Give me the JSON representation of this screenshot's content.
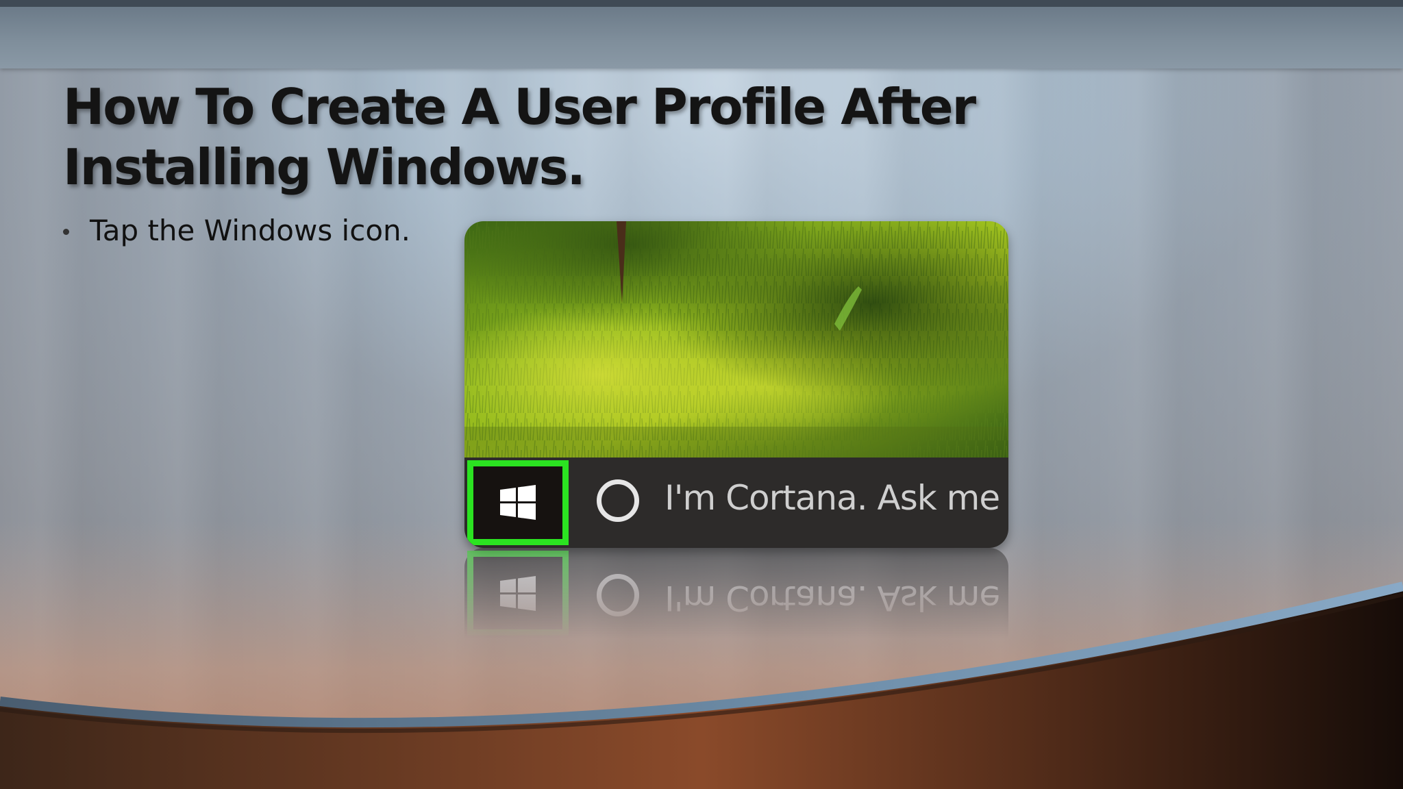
{
  "slide": {
    "title": "How To Create A User Profile After Installing Windows.",
    "bullets": [
      {
        "text": "Tap the Windows icon."
      }
    ]
  },
  "screenshot": {
    "taskbar": {
      "start_icon": "windows-logo-icon",
      "cortana_icon": "cortana-circle-icon",
      "search_text": "I'm Cortana. Ask me an"
    },
    "highlight_color": "#2be321"
  },
  "colors": {
    "title_text": "#141414",
    "taskbar_bg": "#2d2b2a",
    "highlight": "#2be321"
  }
}
